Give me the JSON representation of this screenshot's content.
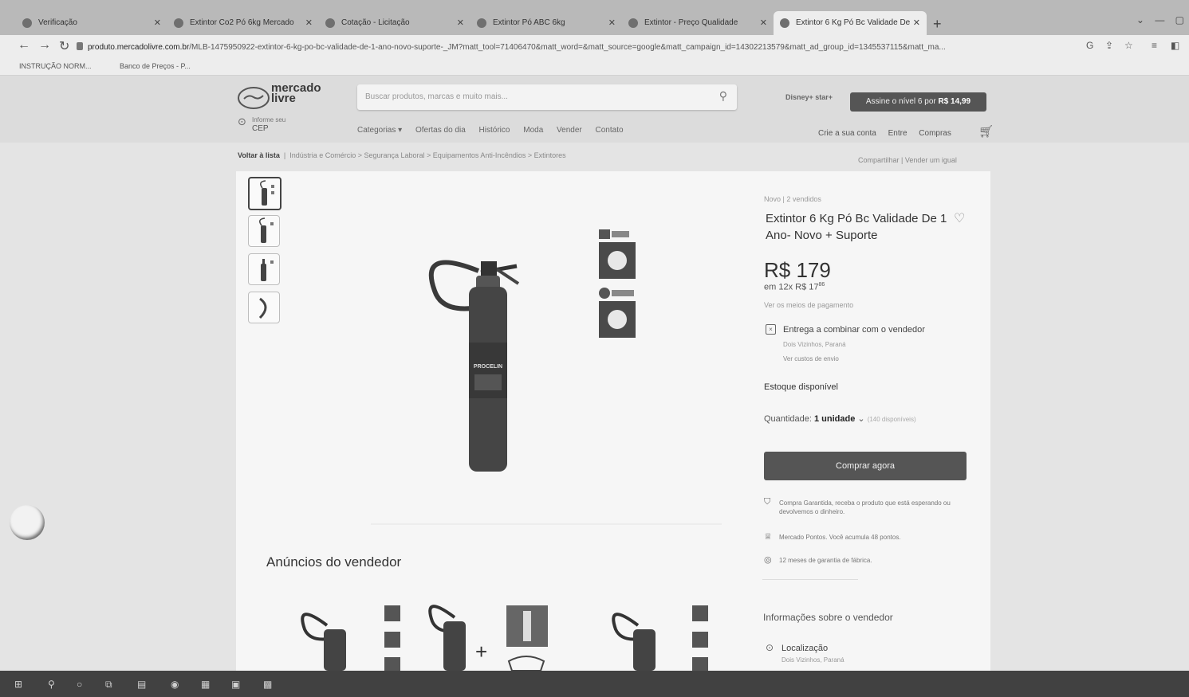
{
  "browser": {
    "tabs": [
      {
        "label": "Verificação"
      },
      {
        "label": "Extintor Co2 Pó 6kg Mercado"
      },
      {
        "label": "Cotação - Licitação"
      },
      {
        "label": "Extintor Pó ABC 6kg"
      },
      {
        "label": "Extintor - Preço Qualidade"
      },
      {
        "label": "Extintor 6 Kg Pó Bc Validade De"
      }
    ],
    "new_tab": "+",
    "url_domain": "produto.mercadolivre.com.br",
    "url_path": "/MLB-1475950922-extintor-6-kg-po-bc-validade-de-1-ano-novo-suporte-_JM?matt_tool=71406470&matt_word=&matt_source=google&matt_campaign_id=14302213579&matt_ad_group_id=1345537115&matt_ma...",
    "bookmarks": [
      "INSTRUÇÃO NORM...",
      "Banco de Preços - P..."
    ]
  },
  "header": {
    "logo_line1": "mercado",
    "logo_line2": "livre",
    "search_placeholder": "Buscar produtos, marcas e muito mais...",
    "cep_line1": "Informe seu",
    "cep_line2": "CEP",
    "menu": [
      "Categorias ▾",
      "Ofertas do dia",
      "Histórico",
      "Moda",
      "Vender",
      "Contato"
    ],
    "disney": "Disney+ star+",
    "promo_text": "Assine o nível 6 por",
    "promo_price": "R$ 14,99",
    "account": [
      "Crie a sua conta",
      "Entre",
      "Compras"
    ]
  },
  "breadcrumb": {
    "back": "Voltar à lista",
    "path": "Indústria e Comércio > Segurança Laboral > Equipamentos Anti-Incêndios > Extintores",
    "share": "Compartilhar  |  Vender um igual"
  },
  "product": {
    "condition": "Novo  |  2 vendidos",
    "title": "Extintor 6 Kg Pó Bc Validade De 1 Ano- Novo + Suporte",
    "price": "R$ 179",
    "installments_main": "em 12x R$ 17",
    "installments_cents": "86",
    "payment_link": "Ver os meios de pagamento",
    "shipping": "Entrega a combinar com o vendedor",
    "shipping_location": "Dois Vizinhos, Paraná",
    "shipping_more": "Ver custos de envio",
    "stock": "Estoque disponível",
    "quantity_label": "Quantidade:",
    "quantity_value": "1 unidade",
    "quantity_available": "(140 disponíveis)",
    "buy_button": "Comprar agora",
    "benefits": [
      "Compra Garantida, receba o produto que está esperando ou devolvemos o dinheiro.",
      "Mercado Pontos. Você acumula 48 pontos.",
      "12 meses de garantia de fábrica."
    ],
    "cylinder_brand": "PROCELIN"
  },
  "seller": {
    "heading": "Informações sobre o vendedor",
    "location_label": "Localização",
    "location_value": "Dois Vizinhos, Paraná"
  },
  "ads": {
    "heading": "Anúncios do vendedor"
  },
  "colors": {
    "header_bg": "#dcdcdc",
    "primary_button": "#555555",
    "page_bg": "#e4e4e4"
  }
}
